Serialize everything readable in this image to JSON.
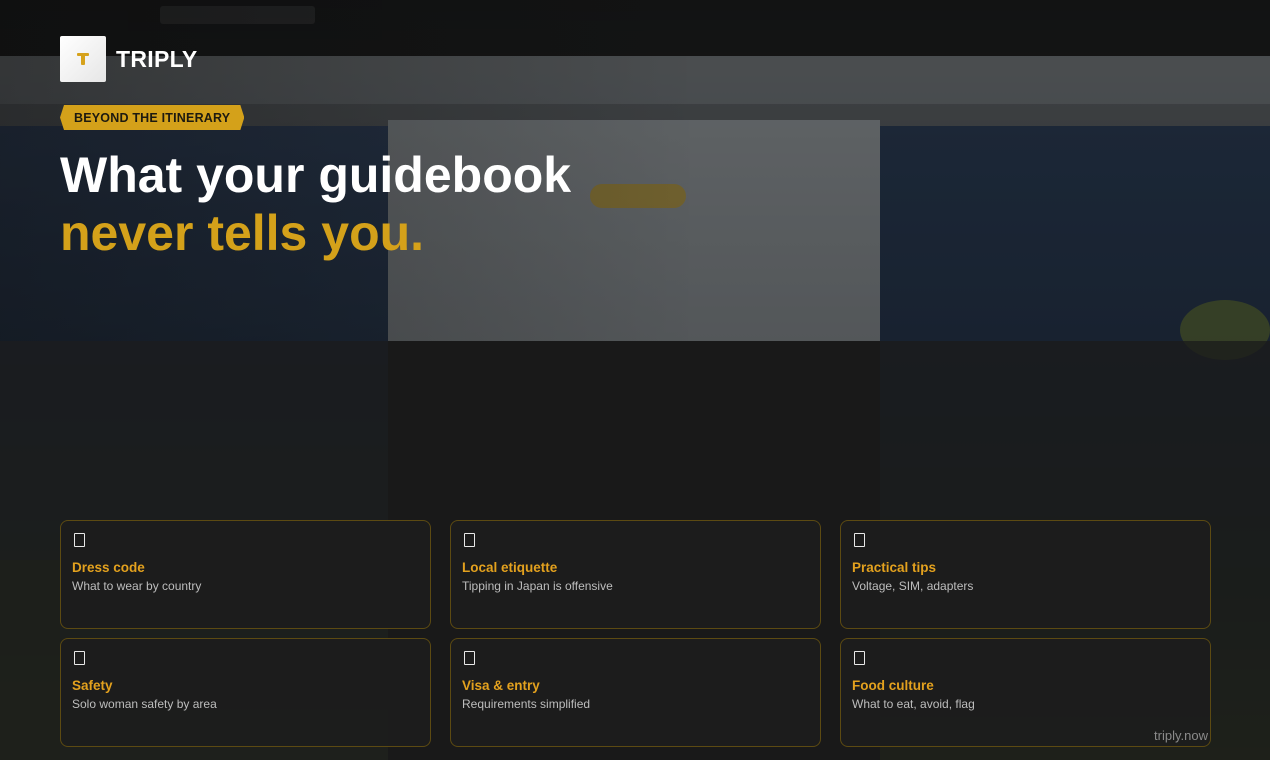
{
  "brand": {
    "name": "TRIPLY",
    "logo_icon": "t-logo-icon",
    "accent_color": "#d4a11a"
  },
  "hero": {
    "badge": "BEYOND THE ITINERARY",
    "headline_line1": "What your guidebook",
    "headline_line2": "never tells you."
  },
  "features": [
    {
      "icon": "document-icon",
      "title": "Dress code",
      "desc": "What to wear by country"
    },
    {
      "icon": "document-icon",
      "title": "Local etiquette",
      "desc": "Tipping in Japan is offensive"
    },
    {
      "icon": "document-icon",
      "title": "Practical tips",
      "desc": "Voltage, SIM, adapters"
    },
    {
      "icon": "document-icon",
      "title": "Safety",
      "desc": "Solo woman safety by area"
    },
    {
      "icon": "document-icon",
      "title": "Visa & entry",
      "desc": "Requirements simplified"
    },
    {
      "icon": "document-icon",
      "title": "Food culture",
      "desc": "What to eat, avoid, flag"
    }
  ],
  "footer": {
    "url": "triply.now"
  }
}
